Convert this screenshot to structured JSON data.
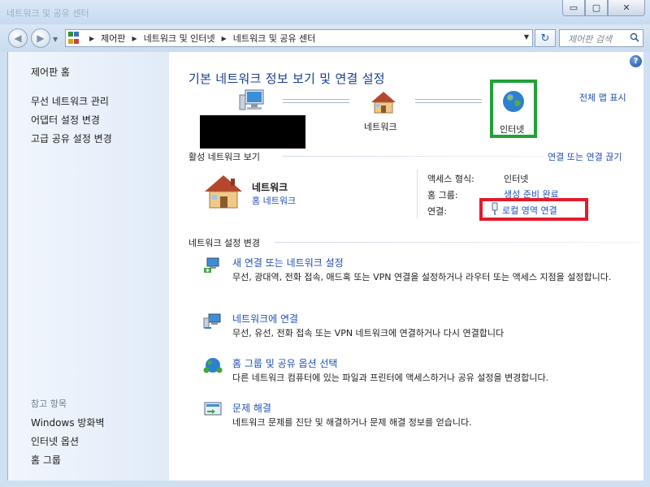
{
  "window": {
    "title": "네트워크 및 공유 센터",
    "minimize_glyph": "▭",
    "maximize_glyph": "▢",
    "close_glyph": "✕"
  },
  "navigation": {
    "back_glyph": "◀",
    "forward_glyph": "▶",
    "history_glyph": "▼",
    "breadcrumbs": [
      "제어판",
      "네트워크 및 인터넷",
      "네트워크 및 공유 센터"
    ],
    "address_dropdown_glyph": "▼",
    "refresh_glyph": "↻",
    "search_placeholder": "제어판 검색"
  },
  "sidebar": {
    "items": [
      "제어판 홈",
      "무선 네트워크 관리",
      "어댑터 설정 변경",
      "고급 공유 설정 변경"
    ],
    "see_also_header": "참고 항목",
    "see_also": [
      "Windows 방화벽",
      "인터넷 옵션",
      "홈 그룹"
    ]
  },
  "main": {
    "help_glyph": "?",
    "title": "기본 네트워크 정보 보기 및 연결 설정",
    "show_full_map": "전체 맵 표시",
    "map": {
      "network_label": "네트워크",
      "internet_label": "인터넷"
    },
    "active_section": {
      "header": "활성 네트워크 보기",
      "connect_link": "연결 또는 연결 끊기",
      "network_name": "네트워크",
      "network_type": "홈 네트워크",
      "access_type_label": "액세스 형식:",
      "access_type_value": "인터넷",
      "homegroup_label": "홈 그룹:",
      "homegroup_value": "생성 준비 완료",
      "connections_label": "연결:",
      "connections_value": "로컬 영역 연결"
    },
    "change_section": {
      "header": "네트워크 설정 변경",
      "tasks": [
        {
          "title": "새 연결 또는 네트워크 설정",
          "desc": "무선, 광대역, 전화 접속, 애드혹 또는 VPN 연결을 설정하거나 라우터 또는 액세스 지점을 설정합니다."
        },
        {
          "title": "네트워크에 연결",
          "desc": "무선, 유선, 전화 접속 또는 VPN 네트워크에 연결하거나 다시 연결합니다"
        },
        {
          "title": "홈 그룹 및 공유 옵션 선택",
          "desc": "다른 네트워크 컴퓨터에 있는 파일과 프린터에 액세스하거나 공유 설정을 변경합니다."
        },
        {
          "title": "문제 해결",
          "desc": "네트워크 문제를 진단 및 해결하거나 문제 해결 정보를 얻습니다."
        }
      ]
    }
  },
  "colors": {
    "link": "#1f50b4",
    "title": "#1a3d8c",
    "highlight_green": "#1fa237",
    "highlight_red": "#e21b2c"
  }
}
